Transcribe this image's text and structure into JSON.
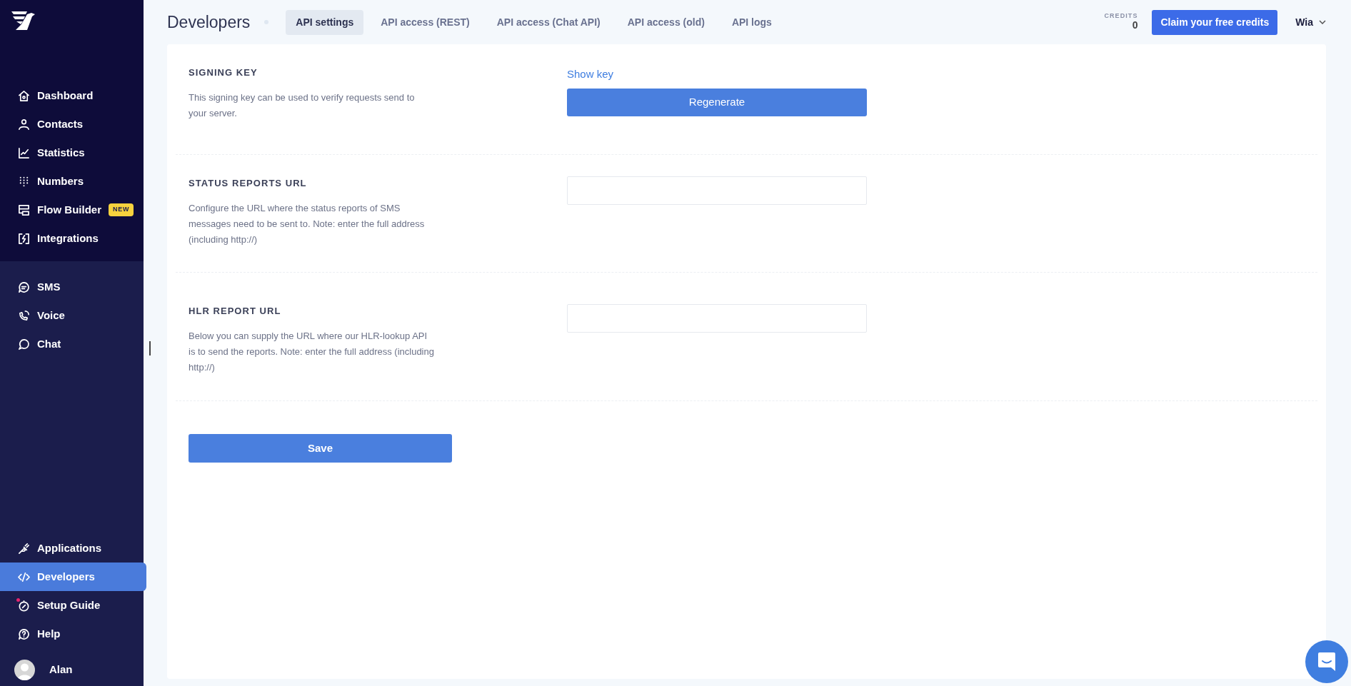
{
  "sidebar": {
    "groups": [
      {
        "items": [
          {
            "label": "Dashboard",
            "selected": false,
            "dot": false
          },
          {
            "label": "Contacts",
            "selected": false,
            "dot": false
          },
          {
            "label": "Statistics",
            "selected": false,
            "dot": false
          },
          {
            "label": "Numbers",
            "selected": false,
            "dot": false
          },
          {
            "label": "Flow Builder",
            "selected": false,
            "dot": false,
            "badge": "NEW"
          },
          {
            "label": "Integrations",
            "selected": false,
            "dot": false
          }
        ]
      },
      {
        "items": [
          {
            "label": "SMS",
            "selected": false,
            "dot": false
          },
          {
            "label": "Voice",
            "selected": false,
            "dot": false
          },
          {
            "label": "Chat",
            "selected": false,
            "dot": false
          }
        ]
      },
      {
        "items": [
          {
            "label": "Applications",
            "selected": false,
            "dot": false
          },
          {
            "label": "Developers",
            "selected": true,
            "dot": false
          },
          {
            "label": "Setup Guide",
            "selected": false,
            "dot": true
          },
          {
            "label": "Help",
            "selected": false,
            "dot": false
          }
        ]
      }
    ],
    "user": {
      "name": "Alan"
    }
  },
  "header": {
    "title": "Developers",
    "tabs": [
      {
        "label": "API settings",
        "selected": true
      },
      {
        "label": "API access (REST)",
        "selected": false
      },
      {
        "label": "API access (Chat API)",
        "selected": false
      },
      {
        "label": "API access (old)",
        "selected": false
      },
      {
        "label": "API logs",
        "selected": false
      }
    ],
    "credits": {
      "label": "CREDITS",
      "value": "0"
    },
    "claim_button": "Claim your free credits",
    "account": "Wia"
  },
  "sections": [
    {
      "kind": "key",
      "title": "SIGNING KEY",
      "description": "This signing key can be used to verify requests send to your server.",
      "link": "Show key",
      "button": "Regenerate"
    },
    {
      "kind": "url",
      "title": "STATUS REPORTS URL",
      "description": "Configure the URL where the status reports of SMS messages need to be sent to. Note: enter the full address (including http://)"
    },
    {
      "kind": "url",
      "title": "HLR REPORT URL",
      "description": "Below you can supply the URL where our HLR-lookup API is to send the reports. Note: enter the full address (including http://)"
    }
  ],
  "save_button": "Save"
}
